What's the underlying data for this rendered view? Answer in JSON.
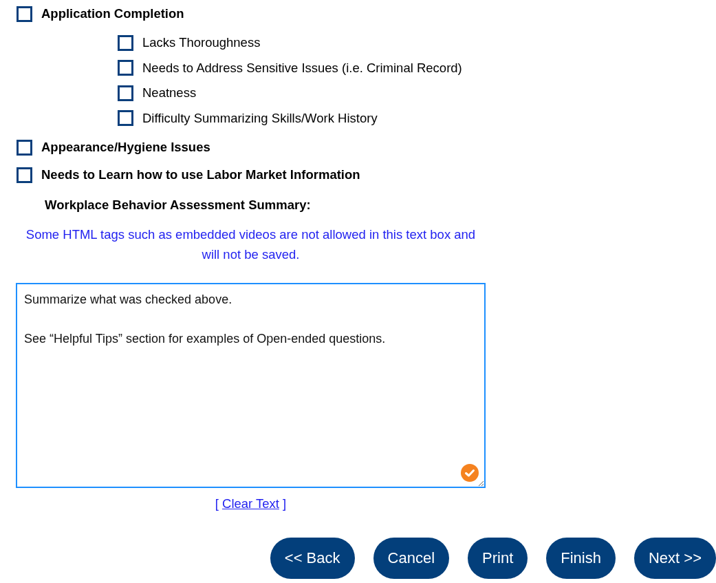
{
  "checklist": [
    {
      "label": "Application Completion",
      "checked": false,
      "children": [
        {
          "label": "Lacks Thoroughness",
          "checked": false
        },
        {
          "label": "Needs to Address Sensitive Issues (i.e. Criminal Record)",
          "checked": false
        },
        {
          "label": "Neatness",
          "checked": false
        },
        {
          "label": "Difficulty Summarizing Skills/Work History",
          "checked": false
        }
      ]
    },
    {
      "label": "Appearance/Hygiene Issues",
      "checked": false
    },
    {
      "label": "Needs to Learn how to use Labor Market Information",
      "checked": false
    }
  ],
  "summary": {
    "heading": "Workplace Behavior Assessment Summary:",
    "notice": "Some HTML tags such as embedded videos are not allowed in this text box and will not be saved.",
    "textarea": {
      "value": "Summarize what was checked above.\n\nSee “Helpful Tips” section for examples of Open-ended questions.",
      "focused": true
    },
    "clear_text": {
      "open": "[",
      "link": "Clear Text",
      "close": "]"
    }
  },
  "buttons": [
    {
      "label": "<< Back"
    },
    {
      "label": "Cancel"
    },
    {
      "label": "Print"
    },
    {
      "label": "Finish"
    },
    {
      "label": "Next >>"
    }
  ]
}
